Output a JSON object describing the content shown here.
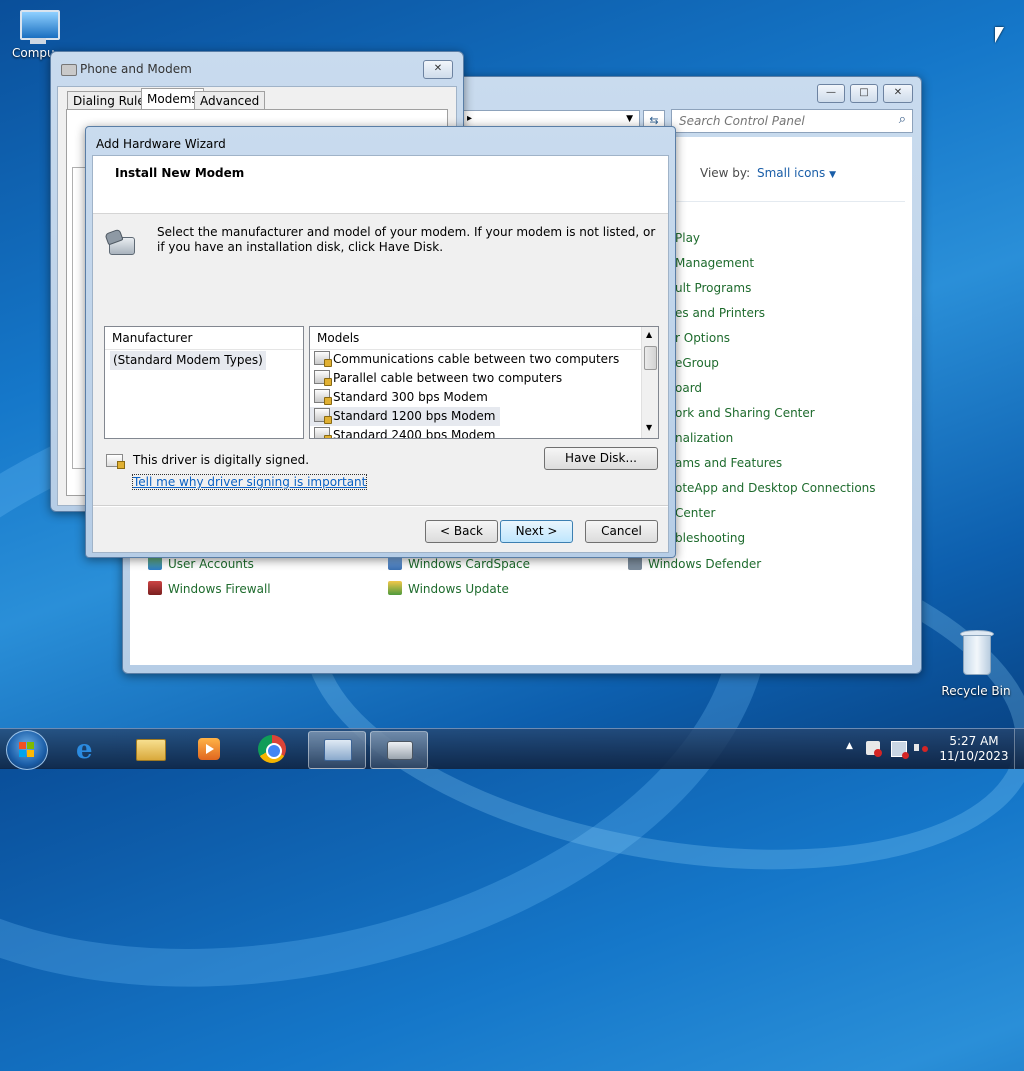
{
  "desktop": {
    "computer_label": "Compu",
    "recycle_bin_label": "Recycle Bin"
  },
  "phone_modem": {
    "title": "Phone and Modem",
    "close_glyph": "✕",
    "tabs": [
      "Dialing Rules",
      "Modems",
      "Advanced"
    ]
  },
  "control_panel": {
    "search_placeholder": "Search Control Panel",
    "view_by_label": "View by:",
    "view_by_value": "Small icons",
    "right_items": [
      "Play",
      "Management",
      "ult Programs",
      "es and Printers",
      "r Options",
      "eGroup",
      "oard",
      "ork and Sharing Center",
      "nalization",
      "ams and Features",
      "oteApp and Desktop Connections",
      "Center",
      "bleshooting",
      "Windows Defender"
    ],
    "bottom_items": [
      "User Accounts",
      "Windows CardSpace",
      "Windows Firewall",
      "Windows Update"
    ]
  },
  "wizard": {
    "title": "Add Hardware Wizard",
    "heading": "Install New Modem",
    "instruction": "Select the manufacturer and model of your modem. If your modem is not listed, or if you have an installation disk, click Have Disk.",
    "manufacturer_header": "Manufacturer",
    "manufacturers": [
      "(Standard Modem Types)"
    ],
    "models_header": "Models",
    "models": [
      "Communications cable between two computers",
      "Parallel cable between two computers",
      "Standard  300 bps Modem",
      "Standard  1200 bps Modem",
      "Standard  2400 bps Modem"
    ],
    "signed_text": "This driver is digitally signed.",
    "signing_link": "Tell me why driver signing is important",
    "have_disk_label": "Have Disk...",
    "back_label": "< Back",
    "next_label": "Next >",
    "cancel_label": "Cancel"
  },
  "taskbar": {
    "time": "5:27 AM",
    "date": "11/10/2023"
  }
}
